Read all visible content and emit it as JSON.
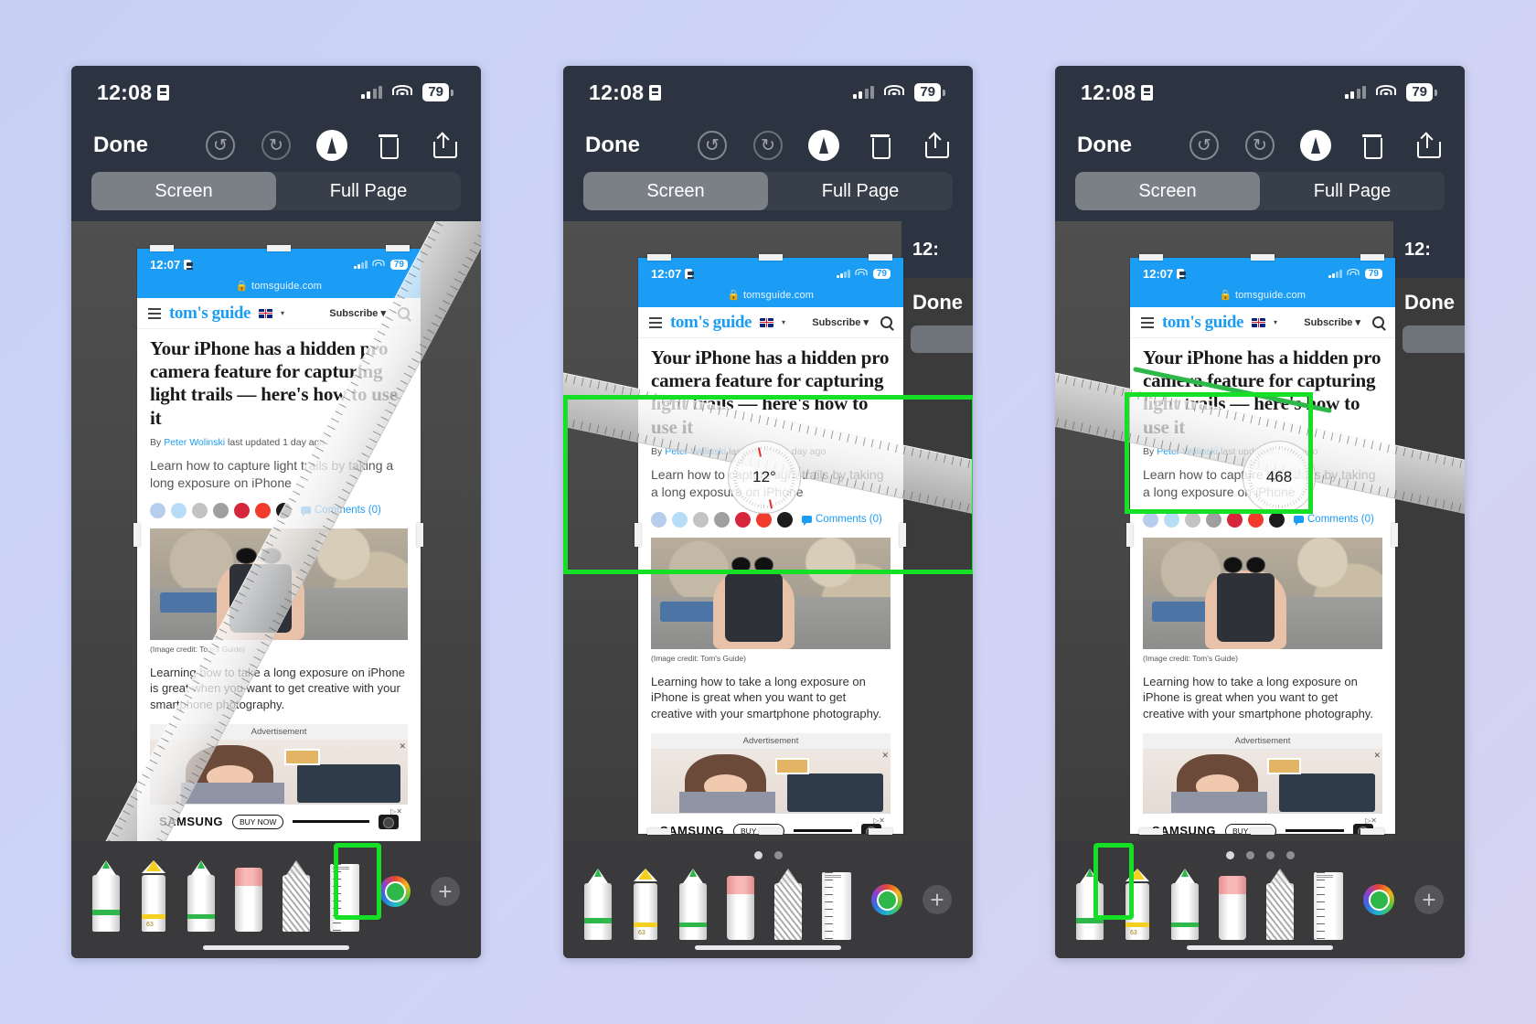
{
  "meta": {
    "description": "iOS screenshot markup editor tutorial, three steps showing the ruler tool",
    "accent_green": "#15e025",
    "ios_blue": "#1b9df5",
    "tray_bg": "#3a3a3c",
    "nav_bg": "#2b3440"
  },
  "status_bar": {
    "time": "12:08",
    "battery": "79",
    "lock_icon": "lock-icon",
    "wifi_icon": "wifi-icon",
    "signal_icon": "signal-bars-icon"
  },
  "nav": {
    "done_label": "Done",
    "undo_icon": "undo-icon",
    "redo_icon": "redo-icon",
    "markup_icon": "markup-pen-icon",
    "delete_icon": "trash-icon",
    "share_icon": "share-icon"
  },
  "segmented": {
    "screen_label": "Screen",
    "full_page_label": "Full Page",
    "selected": "Screen"
  },
  "webpage": {
    "status_time": "12:07",
    "status_battery": "79",
    "url": "tomsguide.com",
    "lock_icon": "lock-icon",
    "brand": "tom's guide",
    "menu_icon": "hamburger-icon",
    "flag_icon": "uk-flag-icon",
    "subscribe_label": "Subscribe",
    "search_icon": "search-icon",
    "headline": "Your iPhone has a hidden pro camera feature for capturing light trails — here's how to use it",
    "byline_prefix": "By",
    "author": "Peter Wolinski",
    "byline_suffix": "last updated 1 day ago",
    "standfirst": "Learn how to capture light trails by taking a long exposure on iPhone",
    "comments_label": "Comments (0)",
    "social_icons": [
      "facebook-icon",
      "twitter-icon",
      "whatsapp-icon",
      "reddit-icon",
      "pinterest-icon",
      "flipboard-icon",
      "email-icon"
    ],
    "social_colors": [
      "#b7cdec",
      "#b6ddf5",
      "#c3c3c3",
      "#9f9f9f",
      "#d6263c",
      "#f03b2d",
      "#1c1c1c"
    ],
    "image_credit": "(Image credit: Tom's Guide)",
    "body_paragraph": "Learning how to take a long exposure on iPhone is great when you want to get creative with your smartphone photography.",
    "ad_label": "Advertisement",
    "ad_brand": "SAMSUNG",
    "ad_cta": "BUY NOW",
    "ad_close_icon": "close-icon",
    "ad_choices_icon": "ad-choices-icon"
  },
  "tools": {
    "items": [
      {
        "name": "pen-tool",
        "label": "Pen"
      },
      {
        "name": "highlighter-tool",
        "label": "Highlighter",
        "badge": "63"
      },
      {
        "name": "pencil-tool",
        "label": "Pencil"
      },
      {
        "name": "eraser-tool",
        "label": "Eraser"
      },
      {
        "name": "lasso-tool",
        "label": "Lasso"
      },
      {
        "name": "ruler-tool",
        "label": "Ruler"
      }
    ],
    "color_picker_icon": "color-wheel-icon",
    "selected_color": "#2fb84a",
    "add_icon": "plus-icon"
  },
  "panels": [
    {
      "id": "panel-1",
      "step": 1,
      "page_dots": {
        "count": 0,
        "active": 0
      },
      "highlight": "ruler-tool",
      "ruler": {
        "visible": true,
        "angle_deg": 20,
        "protractor": null
      }
    },
    {
      "id": "panel-2",
      "step": 2,
      "page_dots": {
        "count": 2,
        "active": 0
      },
      "highlight": "ruler-area",
      "ruler": {
        "visible": true,
        "angle_deg": 12,
        "protractor": "12°"
      }
    },
    {
      "id": "panel-3",
      "step": 3,
      "page_dots": {
        "count": 4,
        "active": 0
      },
      "highlight": "pen-tool",
      "ruler": {
        "visible": true,
        "angle_deg": 12,
        "protractor": "468"
      },
      "drawn_stroke": {
        "color": "#2fb84a",
        "visible": true
      }
    }
  ]
}
